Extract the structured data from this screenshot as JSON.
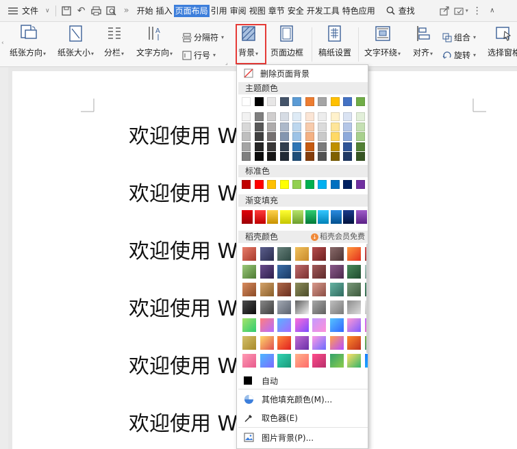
{
  "menubar": {
    "file_label": "文件",
    "tabs": [
      {
        "label": "开始",
        "active": false
      },
      {
        "label": "插入",
        "active": false
      },
      {
        "label": "页面布局",
        "active": true
      },
      {
        "label": "引用",
        "active": false
      },
      {
        "label": "审阅",
        "active": false
      },
      {
        "label": "视图",
        "active": false
      },
      {
        "label": "章节",
        "active": false
      },
      {
        "label": "安全",
        "active": false
      },
      {
        "label": "开发工具",
        "active": false
      },
      {
        "label": "特色应用",
        "active": false
      }
    ],
    "search_label": "查找"
  },
  "ribbon": {
    "orientation": "纸张方向",
    "size": "纸张大小",
    "columns": "分栏",
    "text_direction": "文字方向",
    "separator": "分隔符",
    "line_number": "行号",
    "background": "背景",
    "page_border": "页面边框",
    "manuscript": "稿纸设置",
    "wrap": "文字环绕",
    "align": "对齐",
    "group": "组合",
    "rotate": "旋转",
    "select_pane": "选择窗格"
  },
  "document": {
    "lines": [
      "欢迎使用 W",
      "欢迎使用 W",
      "欢迎使用 W",
      "欢迎使用 W",
      "欢迎使用 W",
      "欢迎使用 W"
    ]
  },
  "dropdown": {
    "delete_bg": "删除页面背景",
    "theme_colors_title": "主题颜色",
    "standard_colors_title": "标准色",
    "gradient_title": "渐变填充",
    "docer_title": "稻壳颜色",
    "docer_member": "稻壳会员免费",
    "auto": "自动",
    "other_fill": "其他填充颜色(M)...",
    "eyedropper": "取色器(E)",
    "picture_bg": "图片背景(P)...",
    "theme_top_row": [
      "#ffffff",
      "#000000",
      "#e7e6e6",
      "#44546a",
      "#5b9bd5",
      "#ed7d31",
      "#a5a5a5",
      "#ffc000",
      "#4472c4",
      "#70ad47"
    ],
    "theme_shades": [
      [
        "#f2f2f2",
        "#7f7f7f",
        "#d0cece",
        "#d6dce4",
        "#deebf6",
        "#fbe5d5",
        "#ededed",
        "#fff2cc",
        "#dae3f3",
        "#e2efd9"
      ],
      [
        "#d8d8d8",
        "#595959",
        "#aeabab",
        "#adb9ca",
        "#bdd7ee",
        "#f7cbac",
        "#dbdbdb",
        "#fee599",
        "#b4c6e7",
        "#c5e0b3"
      ],
      [
        "#bfbfbf",
        "#3f3f3f",
        "#757070",
        "#8496b0",
        "#9dc3e6",
        "#f4b183",
        "#c9c9c9",
        "#ffd965",
        "#8eaadb",
        "#a8d08d"
      ],
      [
        "#a5a5a5",
        "#262626",
        "#3a3838",
        "#323f4f",
        "#2e75b5",
        "#c55a11",
        "#7b7b7b",
        "#bf9000",
        "#2f5496",
        "#538135"
      ],
      [
        "#7f7f7f",
        "#0c0c0c",
        "#171616",
        "#222a35",
        "#1e4e79",
        "#833c0b",
        "#525252",
        "#7f6000",
        "#1f3864",
        "#375623"
      ]
    ],
    "standard_colors": [
      "#c00000",
      "#ff0000",
      "#ffc000",
      "#ffff00",
      "#92d050",
      "#00b050",
      "#00b0f0",
      "#0070c0",
      "#002060",
      "#7030a0"
    ],
    "gradient_colors": [
      [
        "#e0000a",
        "#9c0006"
      ],
      [
        "#ff3b3b",
        "#c00000"
      ],
      [
        "#ffd24d",
        "#c89200"
      ],
      [
        "#ffff33",
        "#c6c600"
      ],
      [
        "#b6e36a",
        "#6c9e2c"
      ],
      [
        "#2ecc71",
        "#007a38"
      ],
      [
        "#33c7ff",
        "#0082b8"
      ],
      [
        "#2c8be0",
        "#00508f"
      ],
      [
        "#1a3a8c",
        "#00123d"
      ],
      [
        "#9f5cc9",
        "#5b2186"
      ]
    ],
    "docer_rows": [
      [
        [
          "#e87d6a",
          "#a83a2c"
        ],
        [
          "#5b5e8c",
          "#2b2d4f"
        ],
        [
          "#66807a",
          "#2f4a44"
        ],
        [
          "#f1c15c",
          "#c98a2a"
        ],
        [
          "#b64d4d",
          "#6e1f1f"
        ],
        [
          "#8a6b6b",
          "#4d3434"
        ],
        [
          "#ff9a3c",
          "#e3301e"
        ],
        [
          "#d94f4f",
          "#7a1c1c"
        ]
      ],
      [
        [
          "#9cc97a",
          "#4d7a33"
        ],
        [
          "#6a4d8c",
          "#2e1f4d"
        ],
        [
          "#3c6ea8",
          "#1a3a66"
        ],
        [
          "#c06b6b",
          "#7a3030"
        ],
        [
          "#a35a5a",
          "#5e2a2a"
        ],
        [
          "#8b5a8b",
          "#4d2a4d"
        ],
        [
          "#4a8a5c",
          "#1f4d2f"
        ],
        [
          "#a9c7bd",
          "#5f8478"
        ]
      ],
      [
        [
          "#d98c5f",
          "#8a4a25"
        ],
        [
          "#d4a36a",
          "#8a5e2a"
        ],
        [
          "#b06a4a",
          "#6a2f1f"
        ],
        [
          "#8c8c5a",
          "#4d4d2a"
        ],
        [
          "#d99a8c",
          "#8a4d44"
        ],
        [
          "#66b3a3",
          "#2f6b5e"
        ],
        [
          "#7a9a7a",
          "#3d5a3d"
        ],
        [
          "#4d8a6a",
          "#1f4d36"
        ]
      ],
      [
        [
          "#4d4d4d",
          "#0c0c0c"
        ],
        [
          "#888888",
          "#3d3d3d"
        ],
        [
          "#a3a9b3",
          "#5c6370"
        ],
        [
          "#5e5e5e",
          "#f2f2f2"
        ],
        [
          "#a8a8a8",
          "#606060"
        ],
        [
          "#bfbfbf",
          "#7a7a7a"
        ],
        [
          "#8c8c8c",
          "#dcdcdc"
        ],
        [
          "#e8e8e8",
          "#a8a8a8"
        ]
      ],
      [
        [
          "#a6e36a",
          "#2ecc71"
        ],
        [
          "#ff7e7e",
          "#b66cff"
        ],
        [
          "#5ab2ff",
          "#a36bff"
        ],
        [
          "#ff6fd8",
          "#7b4dff"
        ],
        [
          "#c49bff",
          "#ff8fd8"
        ],
        [
          "#55c3ff",
          "#3366ff"
        ],
        [
          "#ff9ad5",
          "#7d5cff"
        ],
        [
          "#c56bff",
          "#ff6b9e"
        ]
      ],
      [
        [
          "#d4c06a",
          "#a88a2a"
        ],
        [
          "#ffd76a",
          "#e05050"
        ],
        [
          "#ff8a3c",
          "#e02020"
        ],
        [
          "#c06bd4",
          "#6a2fa8"
        ],
        [
          "#ff9ae3",
          "#6b6bff"
        ],
        [
          "#ffa04d",
          "#b84dff"
        ],
        [
          "#ff8a2a",
          "#c0301e"
        ],
        [
          "#7ab33c",
          "#2a7a9a"
        ]
      ],
      [
        [
          "#ff9ab3",
          "#e85a8c"
        ],
        [
          "#4db8ff",
          "#7a6bff"
        ],
        [
          "#33d4b3",
          "#1a9a7a"
        ],
        [
          "#ffb38a",
          "#ff6b6b"
        ],
        [
          "#ff4d8a",
          "#b82e6b"
        ],
        [
          "#33a36b",
          "#8ccc4d"
        ],
        [
          "#ffe066",
          "#33b36b"
        ],
        [
          "#1a7aff",
          "#1ac6ff"
        ]
      ]
    ]
  }
}
